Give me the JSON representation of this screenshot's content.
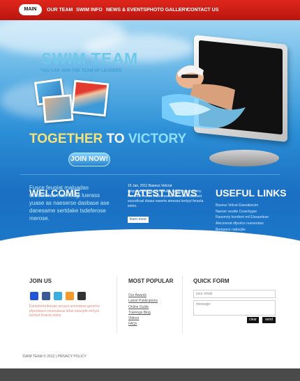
{
  "nav": {
    "items": [
      "MAIN",
      "OUR TEAM",
      "SWIM INFO",
      "NEWS & EVENTS",
      "PHOTO GALLERY",
      "CONTACT US"
    ]
  },
  "hero": {
    "logo": "SWIM TEAM",
    "logo_sub": "YOU CAN JOIN THE TEAM OF LEADERS",
    "tagline_1": "TOGETHER",
    "tagline_2": "TO",
    "tagline_3": "VICTORY",
    "join_button": "JOIN NOW!"
  },
  "welcome": {
    "title": "WELCOME",
    "text": "Fusce feugiat maluadas orbiloreras nae feugi luerass yuase as naeserse dasbase ase danesame sertdake tsdeferose merose."
  },
  "news": {
    "title": "LATEST NEWS",
    "date": "15 Jan, 2011 Baseus Velcrat",
    "text": "adipiscing elitsasiclt vesulld. Ceaerytage omimy hondrerit murse Elasdeasdan danssan altertasd suscelirasl dsasa naserte amessa hertyut feracta setes.",
    "more": "learn more"
  },
  "links": {
    "title": "USEFUL LINKS",
    "items": [
      "Baseus Velcat Elasatipscim",
      "Naeser veulde Ceaertygse",
      "Rasomriy hondrert mil Elssasdean",
      "Aleceserat dfporlce nueseratas",
      "Bertasere nabscjbe",
      "Assertyas hertyuerta ertas"
    ]
  },
  "join_us": {
    "title": "JOIN US",
    "text": "Eariedertunteruae aeruea unceeteae gererrrs efpertiasoo neseulasas lefas natucjde vertyut hertyut feracta setes",
    "social_colors": [
      "#2255d6",
      "#3b5998",
      "#3aaee0",
      "#f39a2a",
      "#333333"
    ],
    "social_names": [
      "flickr-icon",
      "facebook-icon",
      "twitter-icon",
      "rss-icon",
      "delicious-icon"
    ]
  },
  "popular": {
    "title": "MOST POPULAR",
    "items": [
      "Our Awards",
      "Latest Publications",
      "Online Guide",
      "Trainings Blog",
      "Videos",
      "FAQs"
    ]
  },
  "quick_form": {
    "title": "QUICK FORM",
    "email_placeholder": "your email",
    "message_placeholder": "message",
    "clear_label": "clear",
    "send_label": "send"
  },
  "copyright": "SWIM TEAM © 2012 | PRIVACY POLICY",
  "colors": {
    "nav_red": "#d31f16",
    "hero_blue": "#1a6fc2",
    "accent_yellow": "#f5e27a",
    "accent_cyan": "#8fe0ff"
  }
}
